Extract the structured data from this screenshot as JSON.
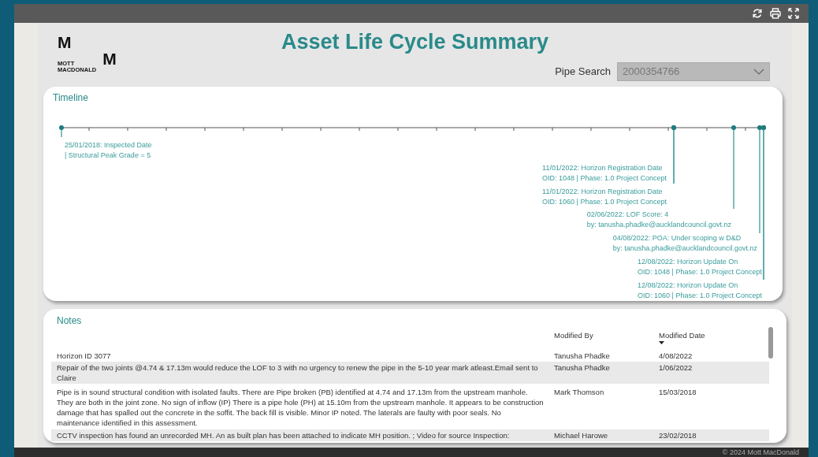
{
  "logo": {
    "letters": [
      "M",
      "M"
    ],
    "name_lines": [
      "MOTT",
      "MACDONALD"
    ]
  },
  "title": "Asset Life Cycle Summary",
  "pipe_search": {
    "label": "Pipe Search",
    "value": "2000354766"
  },
  "timeline": {
    "title": "Timeline",
    "events": [
      {
        "lines": [
          "25/01/2018: Inspected Date",
          "| Structural Peak Grade = 5"
        ]
      },
      {
        "lines": [
          "11/01/2022: Horizon Registration Date",
          "OID: 1048 | Phase: 1.0 Project Concept"
        ]
      },
      {
        "lines": [
          "11/01/2022: Horizon Registration Date",
          "OID: 1060 | Phase: 1.0 Project Concept"
        ]
      },
      {
        "lines": [
          "02/06/2022: LOF Score: 4",
          "by: tanusha.phadke@aucklandcouncil.govt.nz"
        ]
      },
      {
        "lines": [
          "04/08/2022: POA: Under scoping w D&D",
          "by: tanusha.phadke@aucklandcouncil.govt.nz"
        ]
      },
      {
        "lines": [
          "12/08/2022: Horizon Update On",
          "OID: 1048 | Phase: 1.0 Project Concept"
        ]
      },
      {
        "lines": [
          "12/08/2022: Horizon Update On",
          "OID: 1060 | Phase: 1.0 Project Concept"
        ]
      }
    ]
  },
  "notes": {
    "title": "Notes",
    "columns": [
      "",
      "Modified By",
      "Modified Date"
    ],
    "rows": [
      {
        "note": "Horizon ID 3077",
        "modified_by": "Tanusha Phadke",
        "modified_date": "4/08/2022"
      },
      {
        "note": "Repair of the two joints @4.74 & 17.13m would reduce the LOF to 3 with no urgency to renew the pipe in the 5-10 year mark atleast.Email sent to Claire",
        "modified_by": "Tanusha Phadke",
        "modified_date": "1/06/2022"
      },
      {
        "note": "Pipe is in sound structural condition with isolated faults. There are Pipe broken (PB) identified at 4.74 and 17.13m from the upstream manhole. They are both in the joint zone. No sign of inflow (IP) There is a pipe hole (PH) at 15.10m from the upstream manhole. It appears to be construction damage that has spalled out the concrete in the soffit. The back fill is visible. Minor IP noted. The laterals are faulty with poor seals. No maintenance identified in this assessment.",
        "modified_by": "Mark Thomson",
        "modified_date": "15/03/2018"
      },
      {
        "note": "CCTV inspection has found an unrecorded MH. An as built plan has been attached to indicate MH position. ; Video for source Inspection:",
        "modified_by": "Michael Harowe",
        "modified_date": "23/02/2018"
      }
    ]
  },
  "footer": "© 2024 Mott MacDonald"
}
